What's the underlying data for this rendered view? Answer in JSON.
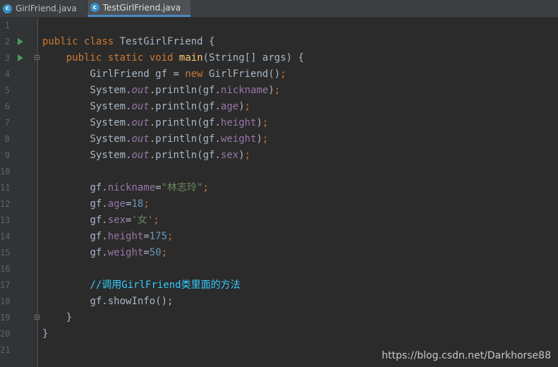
{
  "tabs": [
    {
      "label": "GirlFriend.java",
      "icon": "class-icon",
      "icon_glyph": "c",
      "active": false
    },
    {
      "label": "TestGirlFriend.java",
      "icon": "class-icon",
      "icon_glyph": "c",
      "active": true
    }
  ],
  "code": {
    "class_name": "TestGirlFriend",
    "line_numbers": [
      "1",
      "2",
      "3",
      "4",
      "5",
      "6",
      "7",
      "8",
      "9",
      "10",
      "11",
      "12",
      "13",
      "14",
      "15",
      "16",
      "17",
      "18",
      "19",
      "20",
      "21"
    ],
    "tokens": {
      "public": "public",
      "class": "class",
      "static": "static",
      "void": "void",
      "new": "new",
      "main": "main",
      "string_args": "(String[] args) {",
      "brace_open": " {",
      "brace_close": "}",
      "semi": ";",
      "girlfriend_type": "GirlFriend gf = ",
      "girlfriend_ctor": "GirlFriend()",
      "system": "System.",
      "out": "out",
      "println_open": ".println(gf.",
      "close_paren": ")",
      "gf": "gf.",
      "eq": "=",
      "fields": [
        "nickname",
        "age",
        "height",
        "weight",
        "sex"
      ],
      "assign_nickname": "\"林志玲\"",
      "assign_age": "18",
      "assign_sex": "'女'",
      "assign_height": "175",
      "assign_weight": "50",
      "comment": "//调用GirlFriend类里面的方法",
      "show_info": "showInfo();"
    }
  },
  "watermark": "https://blog.csdn.net/Darkhorse88",
  "colors": {
    "keyword": "#cc7832",
    "method": "#ffc66d",
    "field": "#9876aa",
    "string": "#6a8759",
    "number": "#6897bb",
    "comment": "#33ccff",
    "run": "#499c54",
    "tab_accent": "#4a88c7"
  }
}
